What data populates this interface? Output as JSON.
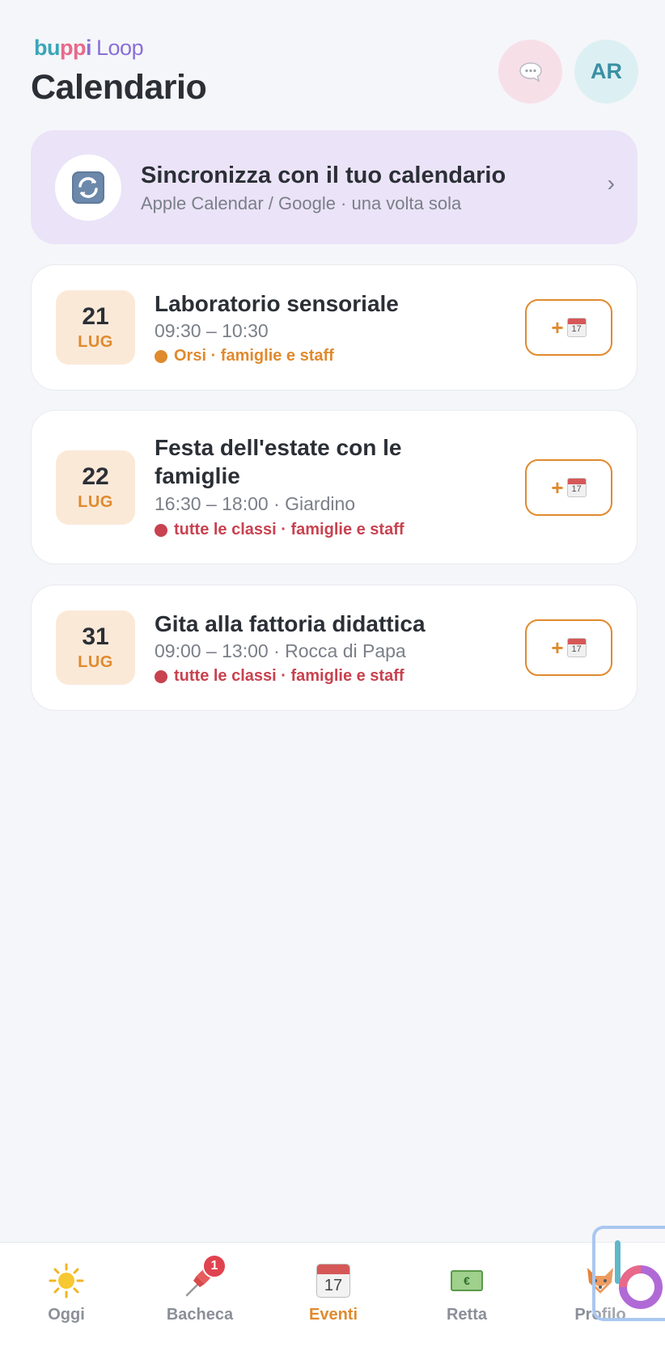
{
  "header": {
    "logo_text_buppi": "buppi",
    "logo_text_loop": "Loop",
    "title": "Calendario",
    "avatar_initials": "AR"
  },
  "sync": {
    "title": "Sincronizza con il tuo calendario",
    "subtitle": "Apple Calendar / Google · una volta sola",
    "chevron": "›"
  },
  "events": [
    {
      "day": "21",
      "month": "LUG",
      "title": "Laboratorio sensoriale",
      "time": "09:30 – 10:30",
      "tag": "Orsi · famiglie e staff",
      "tag_color": "#e08a2e"
    },
    {
      "day": "22",
      "month": "LUG",
      "title": "Festa dell'estate con le famiglie",
      "time": "16:30 – 18:00 · Giardino",
      "tag": "tutte le classi · famiglie e staff",
      "tag_color": "#c8424f"
    },
    {
      "day": "31",
      "month": "LUG",
      "title": "Gita alla fattoria didattica",
      "time": "09:00 – 13:00 · Rocca di Papa",
      "tag": "tutte le classi · famiglie e staff",
      "tag_color": "#c8424f"
    }
  ],
  "add_button": {
    "plus": "+",
    "calendar_day": "17"
  },
  "tabs": [
    {
      "label": "Oggi",
      "icon": "sun-icon"
    },
    {
      "label": "Bacheca",
      "icon": "pushpin-icon",
      "badge": "1"
    },
    {
      "label": "Eventi",
      "icon": "calendar-icon",
      "calendar_day": "17",
      "active": true
    },
    {
      "label": "Retta",
      "icon": "banknote-icon"
    },
    {
      "label": "Profilo",
      "icon": "fox-icon"
    }
  ],
  "colors": {
    "accent": "#e08a2e",
    "sync_bg": "#ebe3f8",
    "date_bg": "#fbe9d8",
    "badge": "#e0434f"
  }
}
